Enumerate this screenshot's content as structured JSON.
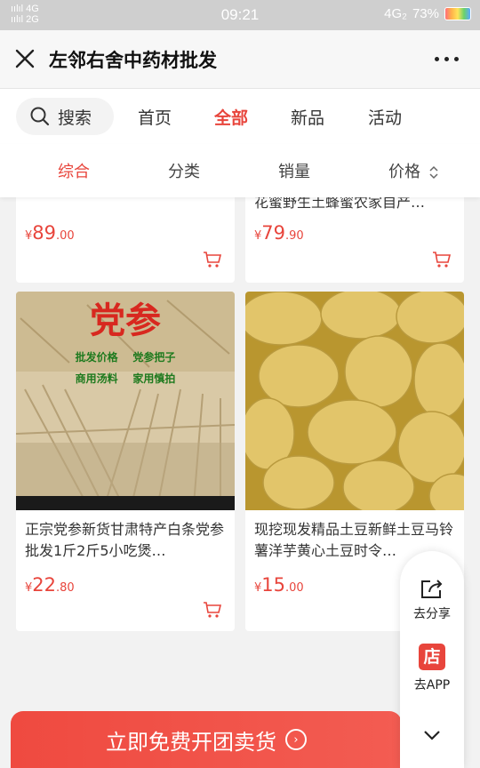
{
  "status": {
    "signal": "4G\n2G",
    "time": "09:21",
    "network": "4G₂",
    "battery": "73%"
  },
  "nav": {
    "title": "左邻右舍中药材批发"
  },
  "tabs": {
    "search": "搜索",
    "home": "首页",
    "all": "全部",
    "new": "新品",
    "events": "活动"
  },
  "sort": {
    "general": "综合",
    "category": "分类",
    "sales": "销量",
    "price": "价格"
  },
  "products": [
    {
      "title": "",
      "price_int": "89",
      "price_dec": ".00"
    },
    {
      "title": "花蜜野生土蜂蜜农家自产…",
      "price_int": "79",
      "price_dec": ".90"
    },
    {
      "title": "正宗党参新货甘肃特产白条党参批发1斤2斤5小吃煲…",
      "price_int": "22",
      "price_dec": ".80",
      "img_text_1": "党参",
      "img_text_2": "批发价格    党参把子",
      "img_text_3": "商用汤料    家用慎拍"
    },
    {
      "title": "现挖现发精品土豆新鲜土豆马铃薯洋芋黄心土豆时令…",
      "price_int": "15",
      "price_dec": ".00"
    }
  ],
  "currency": "¥",
  "float": {
    "share": "去分享",
    "app": "去APP",
    "store_glyph": "店"
  },
  "cta": {
    "label": "立即免费开团卖货"
  },
  "colors": {
    "accent": "#e8453c"
  }
}
